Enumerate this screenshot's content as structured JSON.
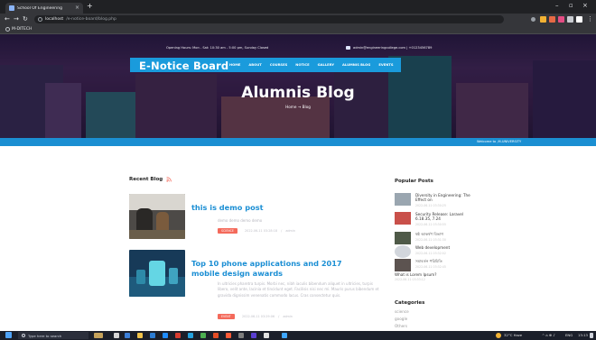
{
  "browser": {
    "tab_title": "School Of Engineering",
    "url_host": "localhost",
    "url_path": "/e-notice-board/blog.php",
    "bookmark_label": "M-DITECH",
    "colors": {
      "chrome_dark": "#202124",
      "chrome_mid": "#35363a"
    }
  },
  "site": {
    "opening_hours": "Opening Hours: Mon - Sat: 10:30 am - 5:00 pm, Sunday Closed",
    "email": "admin@engineeringcollege.com | +0123456789",
    "brand": "E-Notice Board",
    "nav": [
      "HOME",
      "ABOUT",
      "COURSES",
      "NOTICE",
      "GALLERY",
      "ALUMNIS BLOG",
      "EVENTS"
    ],
    "page_title": "Alumnis Blog",
    "breadcrumb_home": "Home",
    "breadcrumb_arrow": "→",
    "breadcrumb_current": "Blog",
    "welcome": "Welcome to ,M-UNIVERSITY",
    "colors": {
      "brand_blue": "#1a9bdc",
      "link_blue": "#1c8fd4",
      "badge_red": "#f46a5b"
    }
  },
  "recent_blog": {
    "heading": "Recent Blog",
    "posts": [
      {
        "title": "this is demo post",
        "excerpt": "demo demo demo demo",
        "badge": "SCIENCE",
        "date": "2022-06-11 03:28:18",
        "sep": "/",
        "author": "admin"
      },
      {
        "title": "Top 10 phone applications and 2017 mobile design awards",
        "excerpt": "In ultricies pharetra turpis. Morbi nec, nibh iaculis bibendum aliquet in ultricies, turpis libero, velit ante, lacinia et tincidunt eget. Facilisis nisi nec mi. Mauris purus bibendum et gravida dignissim venenatis commodo lacus. Cras consectetur quis.",
        "badge": "EVENT",
        "date": "2022-06-11 03:29:06",
        "sep": "/",
        "author": "admin"
      }
    ]
  },
  "popular_posts": {
    "heading": "Popular Posts",
    "items": [
      {
        "title": "Diversity in Engineering: The Effect on",
        "date": "2022-06-11 03:30:25"
      },
      {
        "title": "Security Release: Laravel 6.18.35, 7.24",
        "date": "2022-06-11 03:30:55"
      },
      {
        "title": "ষষ্ঠ আকর্ষণ বিভাগ",
        "date": "2022-06-11 03:31:30"
      },
      {
        "title": "Web development",
        "date": "2022-06-11 03:32:02"
      },
      {
        "title": "সমাবর্তন পরিচিতি",
        "date": "2022-06-11 03:32:45"
      },
      {
        "title": "What is Lorem Ipsum?",
        "date": "2022-06-11 03:33:12"
      }
    ]
  },
  "categories": {
    "heading": "Categories",
    "items": [
      "science",
      "google",
      "Others"
    ]
  },
  "taskbar": {
    "search_placeholder": "Type here to search",
    "weather": "32°C Haze",
    "lang": "ENG",
    "time": "13:13"
  }
}
